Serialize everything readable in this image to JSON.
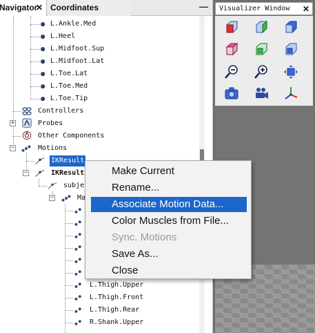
{
  "navigator": {
    "tab_label": "Navigator",
    "tab_close": "✕",
    "coords_tab_label": "Coordinates",
    "minimize_label": "—",
    "markers": [
      "L.Ankle.Med",
      "L.Heel",
      "L.Midfoot.Sup",
      "L.Midfoot.Lat",
      "L.Toe.Lat",
      "L.Toe.Med",
      "L.Toe.Tip"
    ],
    "controllers_label": "Controllers",
    "probes_label": "Probes",
    "other_components_label": "Other Components",
    "motions_label": "Motions",
    "ik_results_selected": "IKResult",
    "ik_results_bold": "IKResult",
    "subject_label": "subje",
    "markers_group_label": "Ma",
    "lower_markers": [
      "L.Thigh.Upper",
      "L.Thigh.Front",
      "L.Thigh.Rear",
      "R.Shank.Upper"
    ],
    "expand_symbol": "+",
    "collapse_symbol": "−"
  },
  "visualizer": {
    "tab_label": "Visualizer Window",
    "tab_close": "✕",
    "tools": [
      "front-view-icon",
      "side-view-icon",
      "back-view-icon",
      "top-view-icon",
      "bottom-view-icon",
      "right-view-icon",
      "zoom-out-icon",
      "zoom-in-icon",
      "fit-view-icon",
      "snapshot-icon",
      "record-movie-icon",
      "axes-icon"
    ]
  },
  "context_menu": {
    "items": [
      {
        "label": "Make Current",
        "state": "normal"
      },
      {
        "label": "Rename...",
        "state": "normal"
      },
      {
        "label": "Associate Motion Data...",
        "state": "active"
      },
      {
        "label": "Color Muscles from File...",
        "state": "normal"
      },
      {
        "label": "Sync. Motions",
        "state": "disabled"
      },
      {
        "label": "Save As...",
        "state": "normal"
      },
      {
        "label": "Close",
        "state": "normal"
      }
    ]
  },
  "colors": {
    "selection": "#1b66c9",
    "visualizer_bg": "#6d6d6d",
    "menu_bg": "#f2f2f2",
    "disabled_text": "#9a9a9a"
  }
}
